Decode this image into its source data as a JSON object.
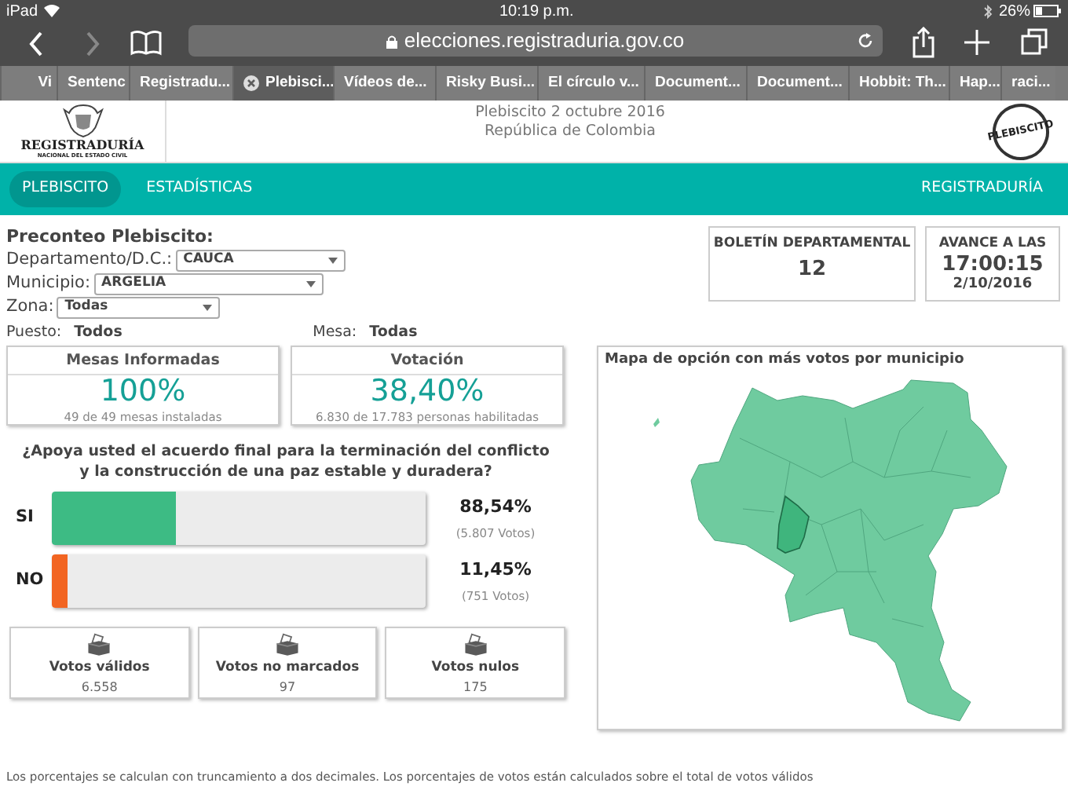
{
  "status_bar": {
    "device": "iPad",
    "time": "10:19 p.m.",
    "battery": "26%"
  },
  "browser": {
    "url": "elecciones.registraduria.gov.co",
    "tabs": [
      {
        "label": "Vi",
        "selected": false
      },
      {
        "label": "Sentenc",
        "selected": false
      },
      {
        "label": "Registradu...",
        "selected": false
      },
      {
        "label": "Plebisci...",
        "selected": true
      },
      {
        "label": "Vídeos de...",
        "selected": false
      },
      {
        "label": "Risky Busi...",
        "selected": false
      },
      {
        "label": "El círculo v...",
        "selected": false
      },
      {
        "label": "Document...",
        "selected": false
      },
      {
        "label": "Document...",
        "selected": false
      },
      {
        "label": "Hobbit: Th...",
        "selected": false
      },
      {
        "label": "Hap...",
        "selected": false
      },
      {
        "label": "raci...",
        "selected": false
      }
    ]
  },
  "header": {
    "logo_text": "REGISTRADURÍA",
    "logo_subtext": "NACIONAL DEL ESTADO CIVIL",
    "title": "Plebiscito 2 octubre 2016",
    "subtitle": "República de Colombia",
    "badge": "PLEBISCITO"
  },
  "nav": {
    "items": [
      {
        "label": "PLEBISCITO",
        "selected": true
      },
      {
        "label": "ESTADÍSTICAS",
        "selected": false
      }
    ],
    "right_link": "REGISTRADURÍA"
  },
  "filters": {
    "heading": "Preconteo Plebiscito:",
    "selects": [
      {
        "label": "Departamento/D.C.:",
        "value": "CAUCA"
      },
      {
        "label": "Municipio:",
        "value": "ARGELIA"
      },
      {
        "label": "Zona:",
        "value": "Todas"
      }
    ],
    "puesto_label": "Puesto:",
    "puesto_value": "Todos",
    "mesa_label": "Mesa:",
    "mesa_value": "Todas"
  },
  "bulletin": {
    "title": "BOLETÍN DEPARTAMENTAL",
    "number": "12"
  },
  "progress_time": {
    "title": "AVANCE A LAS",
    "time": "17:00:15",
    "date": "2/10/2016"
  },
  "stats": [
    {
      "title": "Mesas Informadas",
      "value": "100%",
      "detail": "49 de 49 mesas instaladas"
    },
    {
      "title": "Votación",
      "value": "38,40%",
      "detail": "6.830 de 17.783 personas habilitadas"
    }
  ],
  "question": "¿Apoya usted el acuerdo final para la terminación del conflicto y la construcción de una paz estable y duradera?",
  "options": [
    {
      "label": "SI",
      "level": 0.33,
      "color": "#3dbb84",
      "percent": "88,54%",
      "votes": "(5.807 Votos)"
    },
    {
      "label": "NO",
      "level": 0.04,
      "color": "#f26522",
      "percent": "11,45%",
      "votes": "(751 Votos)"
    }
  ],
  "totals": [
    {
      "label": "Votos válidos",
      "value": "6.558"
    },
    {
      "label": "Votos no marcados",
      "value": "97"
    },
    {
      "label": "Votos nulos",
      "value": "175"
    }
  ],
  "map": {
    "title": "Mapa de opción con más votos por municipio"
  },
  "footnote": "Los porcentajes se calculan con truncamiento a dos decimales. Los porcentajes de votos están calculados sobre el total de votos válidos"
}
